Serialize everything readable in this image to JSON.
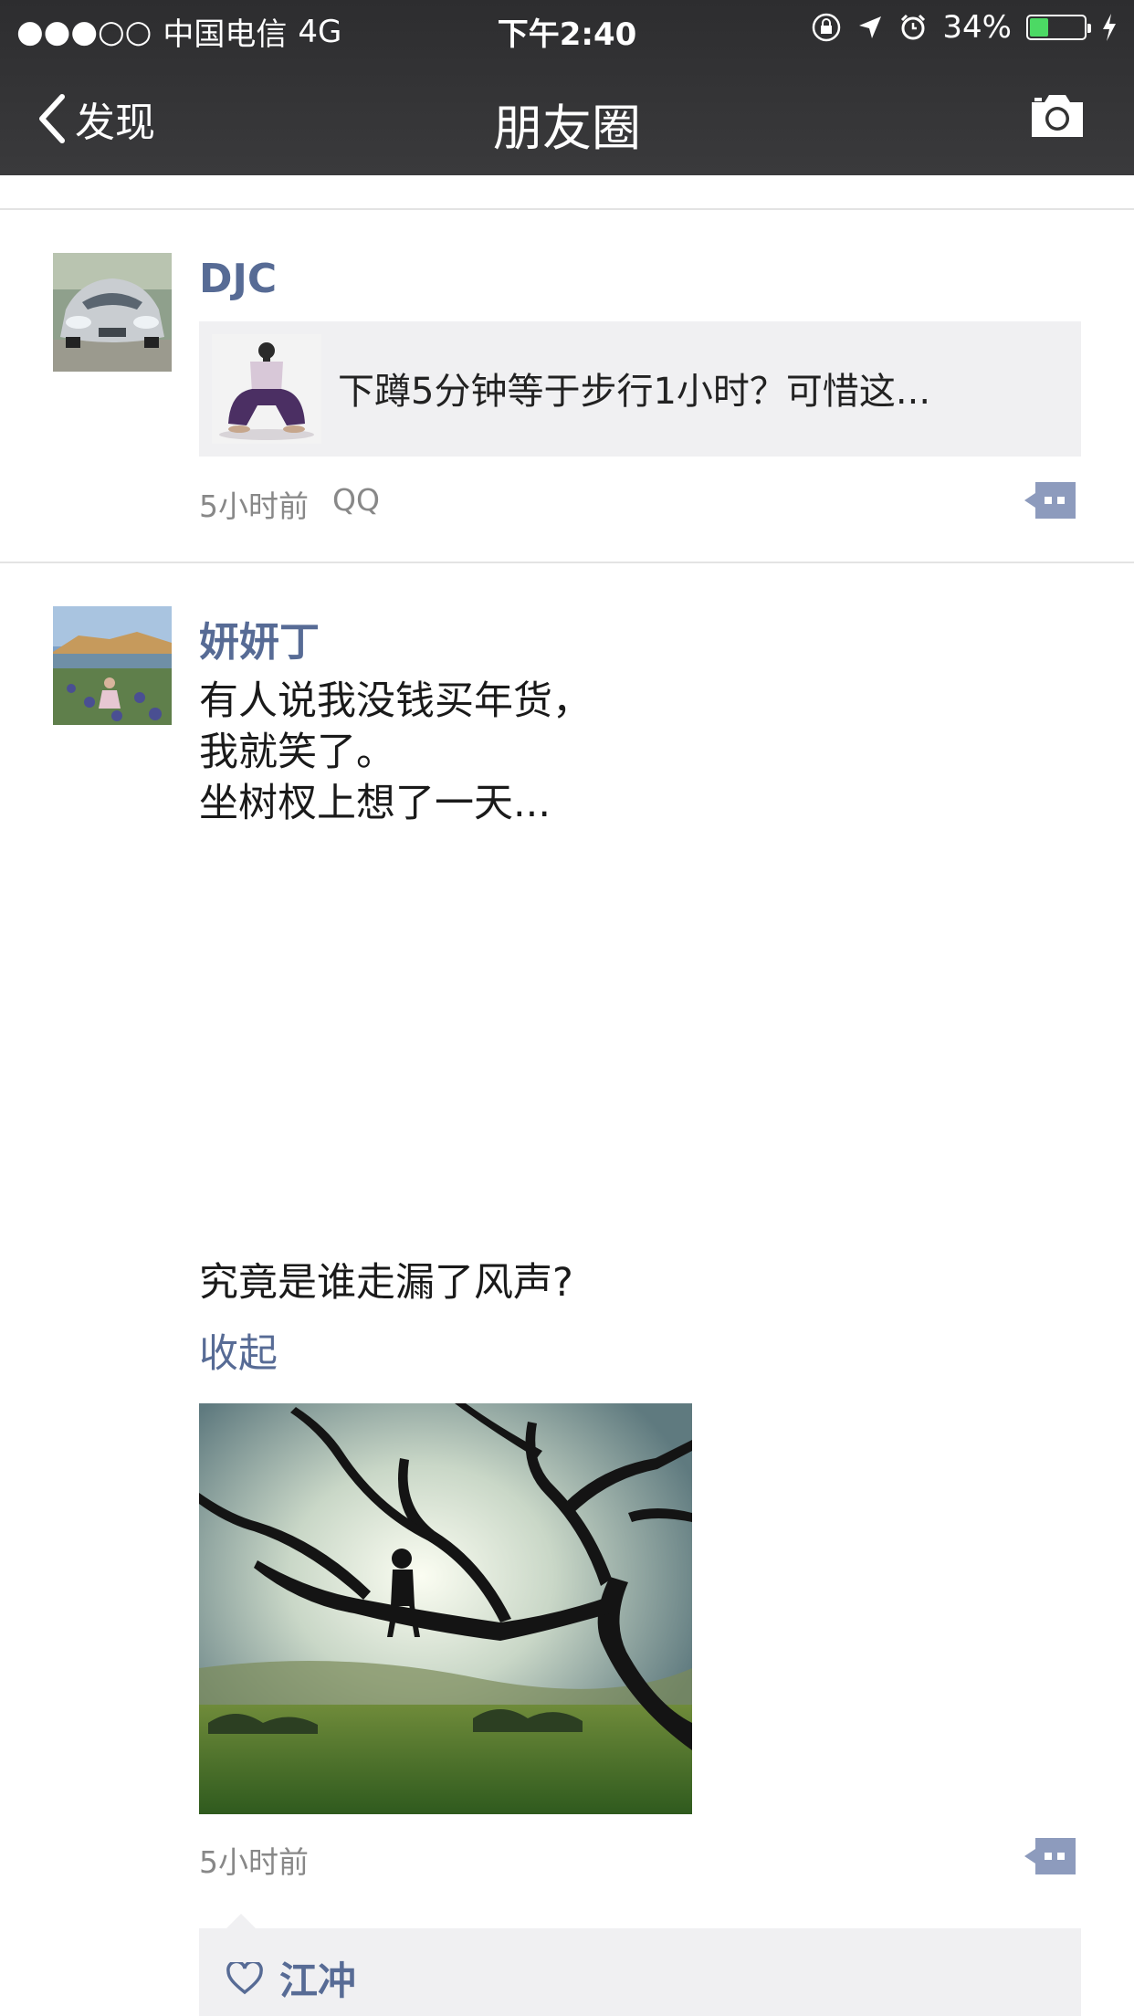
{
  "status_bar": {
    "signal": "●●●○○",
    "carrier": "中国电信",
    "network": "4G",
    "time": "下午2:40",
    "battery_percent_text": "34%",
    "battery_level": 0.34
  },
  "nav": {
    "back_label": "发现",
    "title": "朋友圈"
  },
  "posts": [
    {
      "author": "DJC",
      "shared_link_title": "下蹲5分钟等于步行1小时？可惜这...",
      "time": "5小时前",
      "source": "QQ"
    },
    {
      "author": "妍妍丁",
      "lines": [
        "有人说我没钱买年货，",
        "我就笑了。",
        "坐树杈上想了一天..."
      ],
      "extra_line": "究竟是谁走漏了风声?",
      "collapse_label": "收起",
      "time": "5小时前",
      "likes": [
        "江冲"
      ]
    }
  ],
  "colors": {
    "link_blue": "#576b95",
    "bar_bg": "#2d2d2f",
    "battery_green": "#4cd964"
  }
}
